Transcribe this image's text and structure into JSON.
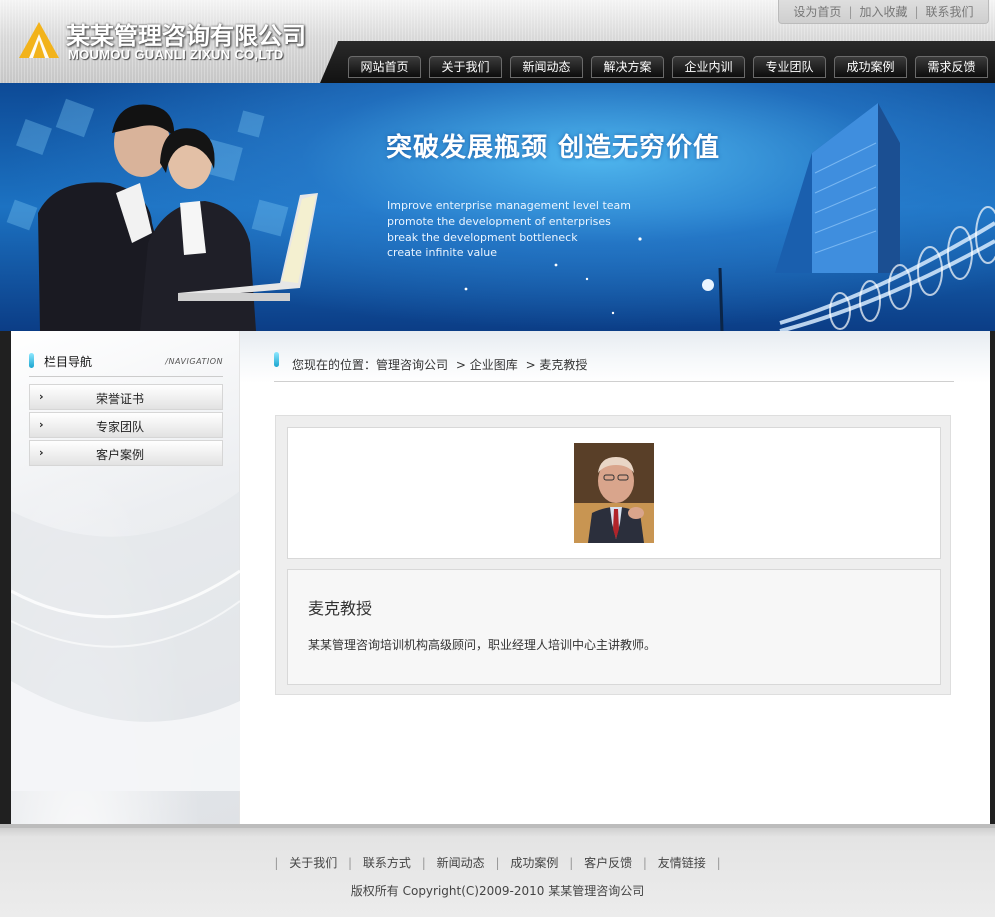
{
  "site": {
    "logo_cn": "某某管理咨询有限公司",
    "logo_en": "MOUMOU GUANLI ZIXUN CO,LTD"
  },
  "topbar": [
    "设为首页",
    "加入收藏",
    "联系我们"
  ],
  "nav": [
    "网站首页",
    "关于我们",
    "新闻动态",
    "解决方案",
    "企业内训",
    "专业团队",
    "成功案例",
    "需求反馈"
  ],
  "banner": {
    "title": "突破发展瓶颈 创造无穷价值",
    "lines": [
      "Improve enterprise management level team",
      "promote the development of enterprises",
      "break the development bottleneck",
      "create infinite value"
    ]
  },
  "sidebar": {
    "title": "栏目导航",
    "subtitle": "/NAVIGATION",
    "items": [
      "荣誉证书",
      "专家团队",
      "客户案例"
    ]
  },
  "breadcrumb": {
    "prefix": "您现在的位置：",
    "items": [
      "管理咨询公司",
      "> 企业图库",
      "> 麦克教授"
    ]
  },
  "detail": {
    "name": "麦克教授",
    "description": "某某管理咨询培训机构高级顾问，职业经理人培训中心主讲教师。"
  },
  "footer": {
    "links": [
      "关于我们",
      "联系方式",
      "新闻动态",
      "成功案例",
      "客户反馈",
      "友情链接"
    ],
    "copyright": "版权所有 Copyright(C)2009-2010 某某管理咨询公司"
  },
  "colors": {
    "banner_blue": "#1c72c2",
    "nav_black": "#121212",
    "accent_cyan": "#1aa5cf",
    "logo_yellow": "#f2b31b"
  },
  "icons": [
    "logo-triangle-icon",
    "blue-bar-icon",
    "arrow-right-icon"
  ]
}
